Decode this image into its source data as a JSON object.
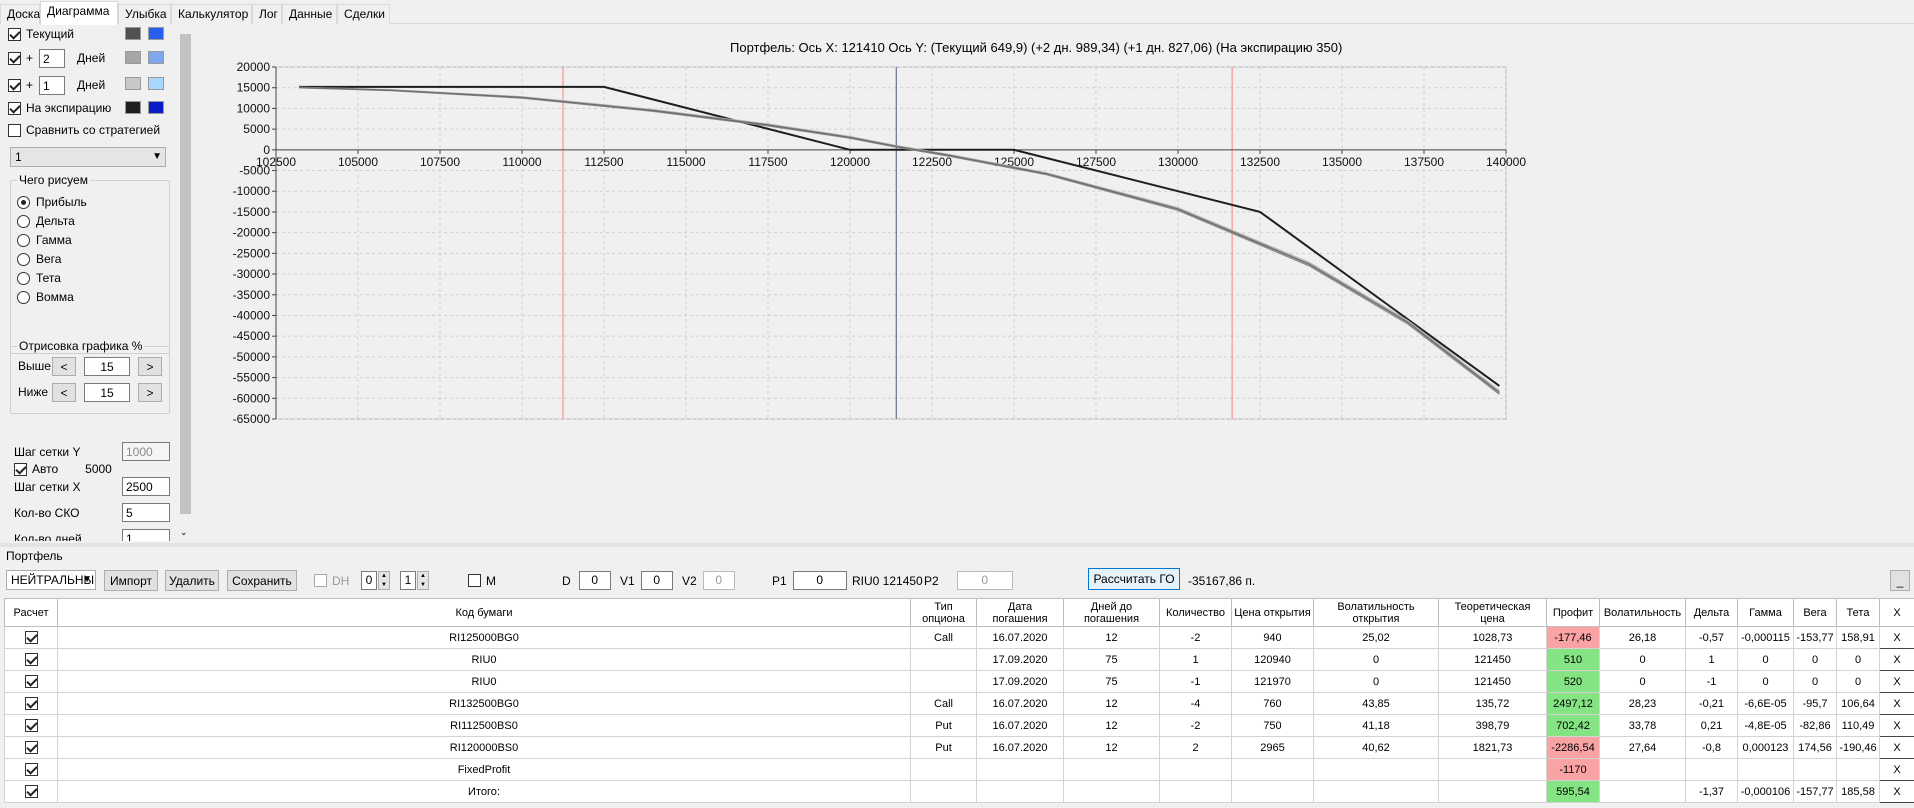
{
  "tabs": [
    {
      "label": "Доска",
      "x": 0,
      "w": 40
    },
    {
      "label": "Диаграмма",
      "x": 40,
      "w": 78
    },
    {
      "label": "Улыбка",
      "x": 118,
      "w": 53
    },
    {
      "label": "Калькулятор",
      "x": 171,
      "w": 81
    },
    {
      "label": "Лог",
      "x": 252,
      "w": 30
    },
    {
      "label": "Данные",
      "x": 282,
      "w": 55
    },
    {
      "label": "Сделки",
      "x": 337,
      "w": 53
    }
  ],
  "left": {
    "current_label": "Текущий",
    "plus": "+",
    "days1": "2",
    "days2": "1",
    "days_label": "Дней",
    "expiry_label": "На экспирацию",
    "compare_label": "Сравнить со стратегией",
    "strategy_value": "1",
    "draw_group": "Чего рисуем",
    "radio": [
      "Прибыль",
      "Дельта",
      "Гамма",
      "Вега",
      "Тета",
      "Вомма"
    ],
    "plot_group": "Отрисовка графика %",
    "above_label": "Выше",
    "above_value": "15",
    "below_label": "Ниже",
    "below_value": "15",
    "lt": "<",
    "gt": ">",
    "grid_y_label": "Шаг сетки Y",
    "grid_y_value": "1000",
    "auto_label": "Авто",
    "auto_value": "5000",
    "grid_x_label": "Шаг сетки X",
    "grid_x_value": "2500",
    "sko_label": "Кол-во СКО",
    "sko_value": "5",
    "days_count_label": "Кол-во дней",
    "days_count_value": "1"
  },
  "colors": {
    "cur_dark": "#505050",
    "cur_blue": "#2a5ef0",
    "d2_gray": "#a6a6a6",
    "d2_blue": "#7fa8f0",
    "d1_gray": "#c8c8c8",
    "d1_blue": "#a8d8ff",
    "exp_dark": "#1e1e1e",
    "exp_blue": "#0a1cc8"
  },
  "chart_title": "Портфель: Ось X: 121410 Ось Y:  (Текущий 649,9)  (+2 дн. 989,34)  (+1 дн. 827,06)  (На экспирацию 350)",
  "chart_data": {
    "type": "line",
    "xlim": [
      102500,
      140000
    ],
    "ylim": [
      -65000,
      20000
    ],
    "x_ticks": [
      102500,
      105000,
      107500,
      110000,
      112500,
      115000,
      117500,
      120000,
      122500,
      125000,
      127500,
      130000,
      132500,
      135000,
      137500,
      140000
    ],
    "y_ticks": [
      20000,
      15000,
      10000,
      5000,
      0,
      -5000,
      -10000,
      -15000,
      -20000,
      -25000,
      -30000,
      -35000,
      -40000,
      -45000,
      -50000,
      -55000,
      -60000,
      -65000
    ],
    "vlines": [
      {
        "x": 111250,
        "color": "#ff8080"
      },
      {
        "x": 121410,
        "color": "#4a5a80"
      },
      {
        "x": 131650,
        "color": "#ff8080"
      }
    ],
    "series": [
      {
        "color": "#1e1e1e",
        "x": [
          103200,
          112500,
          120000,
          125000,
          132500,
          139800
        ],
        "y": [
          15200,
          15200,
          0,
          0,
          -15000,
          -57000
        ]
      },
      {
        "color": "#8c8c8c",
        "x": [
          103200,
          106000,
          110000,
          114000,
          117500,
          120000,
          121410,
          123000,
          126000,
          130000,
          134000,
          137000,
          139800
        ],
        "y": [
          15000,
          14300,
          12500,
          9300,
          5800,
          2800,
          650,
          -1500,
          -6000,
          -14600,
          -28000,
          -42000,
          -59000
        ]
      },
      {
        "color": "#b4b4b4",
        "x": [
          103200,
          106000,
          110000,
          114000,
          117500,
          120000,
          121410,
          123000,
          126000,
          130000,
          134000,
          137000,
          139800
        ],
        "y": [
          15100,
          14500,
          12800,
          9700,
          6200,
          3200,
          990,
          -1100,
          -5600,
          -14000,
          -27200,
          -41200,
          -58200
        ]
      },
      {
        "color": "#6e6e6e",
        "x": [
          103200,
          106000,
          110000,
          114000,
          117500,
          120000,
          121410,
          123000,
          126000,
          130000,
          134000,
          137000,
          139800
        ],
        "y": [
          15050,
          14400,
          12650,
          9500,
          6000,
          3000,
          830,
          -1300,
          -5800,
          -14300,
          -27600,
          -41600,
          -58600
        ]
      }
    ]
  },
  "portfolio_label": "Портфель",
  "toolbar": {
    "strategy": "НЕЙТРАЛЬНЫ",
    "import": "Импорт",
    "delete": "Удалить",
    "save": "Сохранить",
    "dh": "DH",
    "dh_v1": "0",
    "dh_v2": "1",
    "m": "M",
    "d_label": "D",
    "d_value": "0",
    "v1_label": "V1",
    "v1_value": "0",
    "v2_label": "V2",
    "v2_value": "0",
    "p1_label": "P1",
    "p1_value": "0",
    "riu_text": "RIU0 121450",
    "p2_label": "P2",
    "p2_value": "0",
    "calc_go": "Рассчитать ГО",
    "go_value": "-35167,86 п.",
    "minimize": "_"
  },
  "table": {
    "headers": [
      "Расчет",
      "Код бумаги",
      "Тип опциона",
      "Дата погашения",
      "Дней до погашения",
      "Количество",
      "Цена открытия",
      "Волатильность открытия",
      "Теоретическая цена",
      "Профит",
      "Волатильность",
      "Дельта",
      "Гамма",
      "Вега",
      "Тета",
      "X"
    ],
    "rows": [
      {
        "code": "RI125000BG0",
        "type": "Call",
        "date": "16.07.2020",
        "days": "12",
        "qty": "-2",
        "open": "940",
        "vol_open": "25,02",
        "theor": "1028,73",
        "profit": "-177,46",
        "pcolor": "red",
        "vol": "26,18",
        "delta": "-0,57",
        "gamma": "-0,000115",
        "vega": "-153,77",
        "theta": "158,91",
        "x": "X"
      },
      {
        "code": "RIU0",
        "type": "",
        "date": "17.09.2020",
        "days": "75",
        "qty": "1",
        "open": "120940",
        "vol_open": "0",
        "theor": "121450",
        "profit": "510",
        "pcolor": "green",
        "vol": "0",
        "delta": "1",
        "gamma": "0",
        "vega": "0",
        "theta": "0",
        "x": "X"
      },
      {
        "code": "RIU0",
        "type": "",
        "date": "17.09.2020",
        "days": "75",
        "qty": "-1",
        "open": "121970",
        "vol_open": "0",
        "theor": "121450",
        "profit": "520",
        "pcolor": "green",
        "vol": "0",
        "delta": "-1",
        "gamma": "0",
        "vega": "0",
        "theta": "0",
        "x": "X"
      },
      {
        "code": "RI132500BG0",
        "type": "Call",
        "date": "16.07.2020",
        "days": "12",
        "qty": "-4",
        "open": "760",
        "vol_open": "43,85",
        "theor": "135,72",
        "profit": "2497,12",
        "pcolor": "green",
        "vol": "28,23",
        "delta": "-0,21",
        "gamma": "-6,6E-05",
        "vega": "-95,7",
        "theta": "106,64",
        "x": "X"
      },
      {
        "code": "RI112500BS0",
        "type": "Put",
        "date": "16.07.2020",
        "days": "12",
        "qty": "-2",
        "open": "750",
        "vol_open": "41,18",
        "theor": "398,79",
        "profit": "702,42",
        "pcolor": "green",
        "vol": "33,78",
        "delta": "0,21",
        "gamma": "-4,8E-05",
        "vega": "-82,86",
        "theta": "110,49",
        "x": "X"
      },
      {
        "code": "RI120000BS0",
        "type": "Put",
        "date": "16.07.2020",
        "days": "12",
        "qty": "2",
        "open": "2965",
        "vol_open": "40,62",
        "theor": "1821,73",
        "profit": "-2286,54",
        "pcolor": "red",
        "vol": "27,64",
        "delta": "-0,8",
        "gamma": "0,000123",
        "vega": "174,56",
        "theta": "-190,46",
        "x": "X"
      },
      {
        "code": "FixedProfit",
        "type": "",
        "date": "",
        "days": "",
        "qty": "",
        "open": "",
        "vol_open": "",
        "theor": "",
        "profit": "-1170",
        "pcolor": "red",
        "vol": "",
        "delta": "",
        "gamma": "",
        "vega": "",
        "theta": "",
        "x": "X"
      },
      {
        "code": "Итого:",
        "type": "",
        "date": "",
        "days": "",
        "qty": "",
        "open": "",
        "vol_open": "",
        "theor": "",
        "profit": "595,54",
        "pcolor": "green",
        "vol": "",
        "delta": "-1,37",
        "gamma": "-0,000106",
        "vega": "-157,77",
        "theta": "185,58",
        "x": "X"
      }
    ]
  }
}
